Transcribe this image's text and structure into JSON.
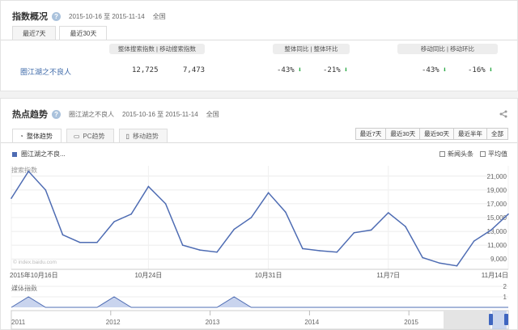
{
  "overview": {
    "title": "指数概况",
    "help": "?",
    "date_range": "2015-10-16 至 2015-11-14",
    "region": "全国",
    "tabs": [
      {
        "label": "最近7天"
      },
      {
        "label": "最近30天"
      }
    ],
    "headers": {
      "overall_index": "整体搜索指数",
      "mobile_index": "移动搜索指数",
      "overall_yoy": "整体同比",
      "overall_mom": "整体环比",
      "mobile_yoy": "移动同比",
      "mobile_mom": "移动环比"
    },
    "keyword": "圈江湖之不良人",
    "overall_index": "12,725",
    "mobile_index": "7,473",
    "overall_yoy": "-43%",
    "overall_mom": "-21%",
    "mobile_yoy": "-43%",
    "mobile_mom": "-16%",
    "down_color": "#2aa845"
  },
  "trend": {
    "title": "热点趋势",
    "help": "?",
    "keyword": "圈江湖之不良人",
    "date_range": "2015-10-16 至 2015-11-14",
    "region": "全国",
    "share_icon": "share-icon",
    "tabs": [
      {
        "label": "整体趋势",
        "icon": "pie-icon"
      },
      {
        "label": "PC趋势",
        "icon": "pc-icon"
      },
      {
        "label": "移动趋势",
        "icon": "mobile-icon"
      }
    ],
    "ranges": [
      "最近7天",
      "最近30天",
      "最近90天",
      "最近半年",
      "全部"
    ],
    "legend_label": "圈江湖之不良...",
    "checkboxes": [
      "新闻头条",
      "平均值"
    ],
    "series_color": "#4e6cb3"
  },
  "chart_data": [
    {
      "type": "line",
      "ylabel": "搜索指数",
      "watermark": "© index.baidu.com",
      "x": [
        "2015-10-16",
        "2015-10-17",
        "2015-10-18",
        "2015-10-19",
        "2015-10-20",
        "2015-10-21",
        "2015-10-22",
        "2015-10-23",
        "2015-10-24",
        "2015-10-25",
        "2015-10-26",
        "2015-10-27",
        "2015-10-28",
        "2015-10-29",
        "2015-10-30",
        "2015-10-31",
        "2015-11-01",
        "2015-11-02",
        "2015-11-03",
        "2015-11-04",
        "2015-11-05",
        "2015-11-06",
        "2015-11-07",
        "2015-11-08",
        "2015-11-09",
        "2015-11-10",
        "2015-11-11",
        "2015-11-12",
        "2015-11-13",
        "2015-11-14"
      ],
      "xtick_labels": [
        "2015年10月16日",
        "10月24日",
        "10月31日",
        "11月7日",
        "11月14日"
      ],
      "xtick_index": [
        0,
        8,
        15,
        22,
        29
      ],
      "series": [
        {
          "name": "圈江湖之不良...",
          "values": [
            17800,
            21700,
            19000,
            12500,
            11400,
            11400,
            14400,
            15500,
            19500,
            17000,
            11000,
            10300,
            10000,
            13300,
            15000,
            18600,
            15800,
            10500,
            10200,
            10000,
            12800,
            13200,
            15700,
            13700,
            9200,
            8400,
            8000,
            11600,
            13200,
            15500
          ]
        }
      ],
      "yticks": [
        21000,
        19000,
        17000,
        15000,
        13000,
        11000,
        9000
      ],
      "ylim": [
        7500,
        22500
      ],
      "grid": true
    },
    {
      "type": "area",
      "ylabel": "媒体指数",
      "x": [
        "2015-10-16",
        "2015-10-17",
        "2015-10-18",
        "2015-10-19",
        "2015-10-20",
        "2015-10-21",
        "2015-10-22",
        "2015-10-23",
        "2015-10-24",
        "2015-10-25",
        "2015-10-26",
        "2015-10-27",
        "2015-10-28",
        "2015-10-29",
        "2015-10-30",
        "2015-10-31",
        "2015-11-01",
        "2015-11-02",
        "2015-11-03",
        "2015-11-04",
        "2015-11-05",
        "2015-11-06",
        "2015-11-07",
        "2015-11-08",
        "2015-11-09",
        "2015-11-10",
        "2015-11-11",
        "2015-11-12",
        "2015-11-13",
        "2015-11-14"
      ],
      "values": [
        0,
        1,
        0,
        0,
        0,
        0,
        1,
        0,
        0,
        0,
        0,
        0,
        0,
        1,
        0,
        0,
        0,
        0,
        0,
        0,
        0,
        0,
        0,
        0,
        0,
        0,
        0,
        0,
        0,
        0
      ],
      "yticks": [
        2,
        1
      ],
      "ylim": [
        0,
        2
      ]
    },
    {
      "type": "area",
      "role": "time-navigator",
      "xtick_labels": [
        "2011",
        "2012",
        "2013",
        "2014",
        "2015"
      ]
    }
  ]
}
